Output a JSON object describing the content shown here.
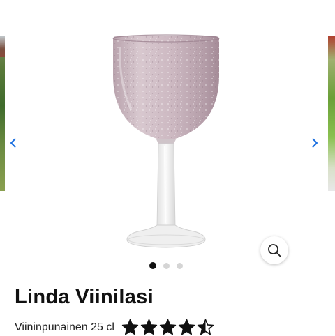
{
  "carousel": {
    "slide_count": 3,
    "active_slide": 1,
    "prev_icon": "chevron-left-icon",
    "next_icon": "chevron-right-icon",
    "zoom_icon": "magnifier-icon",
    "accent_color": "#1a6fe0",
    "image_subject": "wine-glass"
  },
  "product": {
    "title": "Linda Viinilasi",
    "variant": "Viininpunainen 25 cl",
    "rating": 4.5,
    "rating_max": 5,
    "star_icon": "star-icon",
    "star_color": "#111111"
  }
}
